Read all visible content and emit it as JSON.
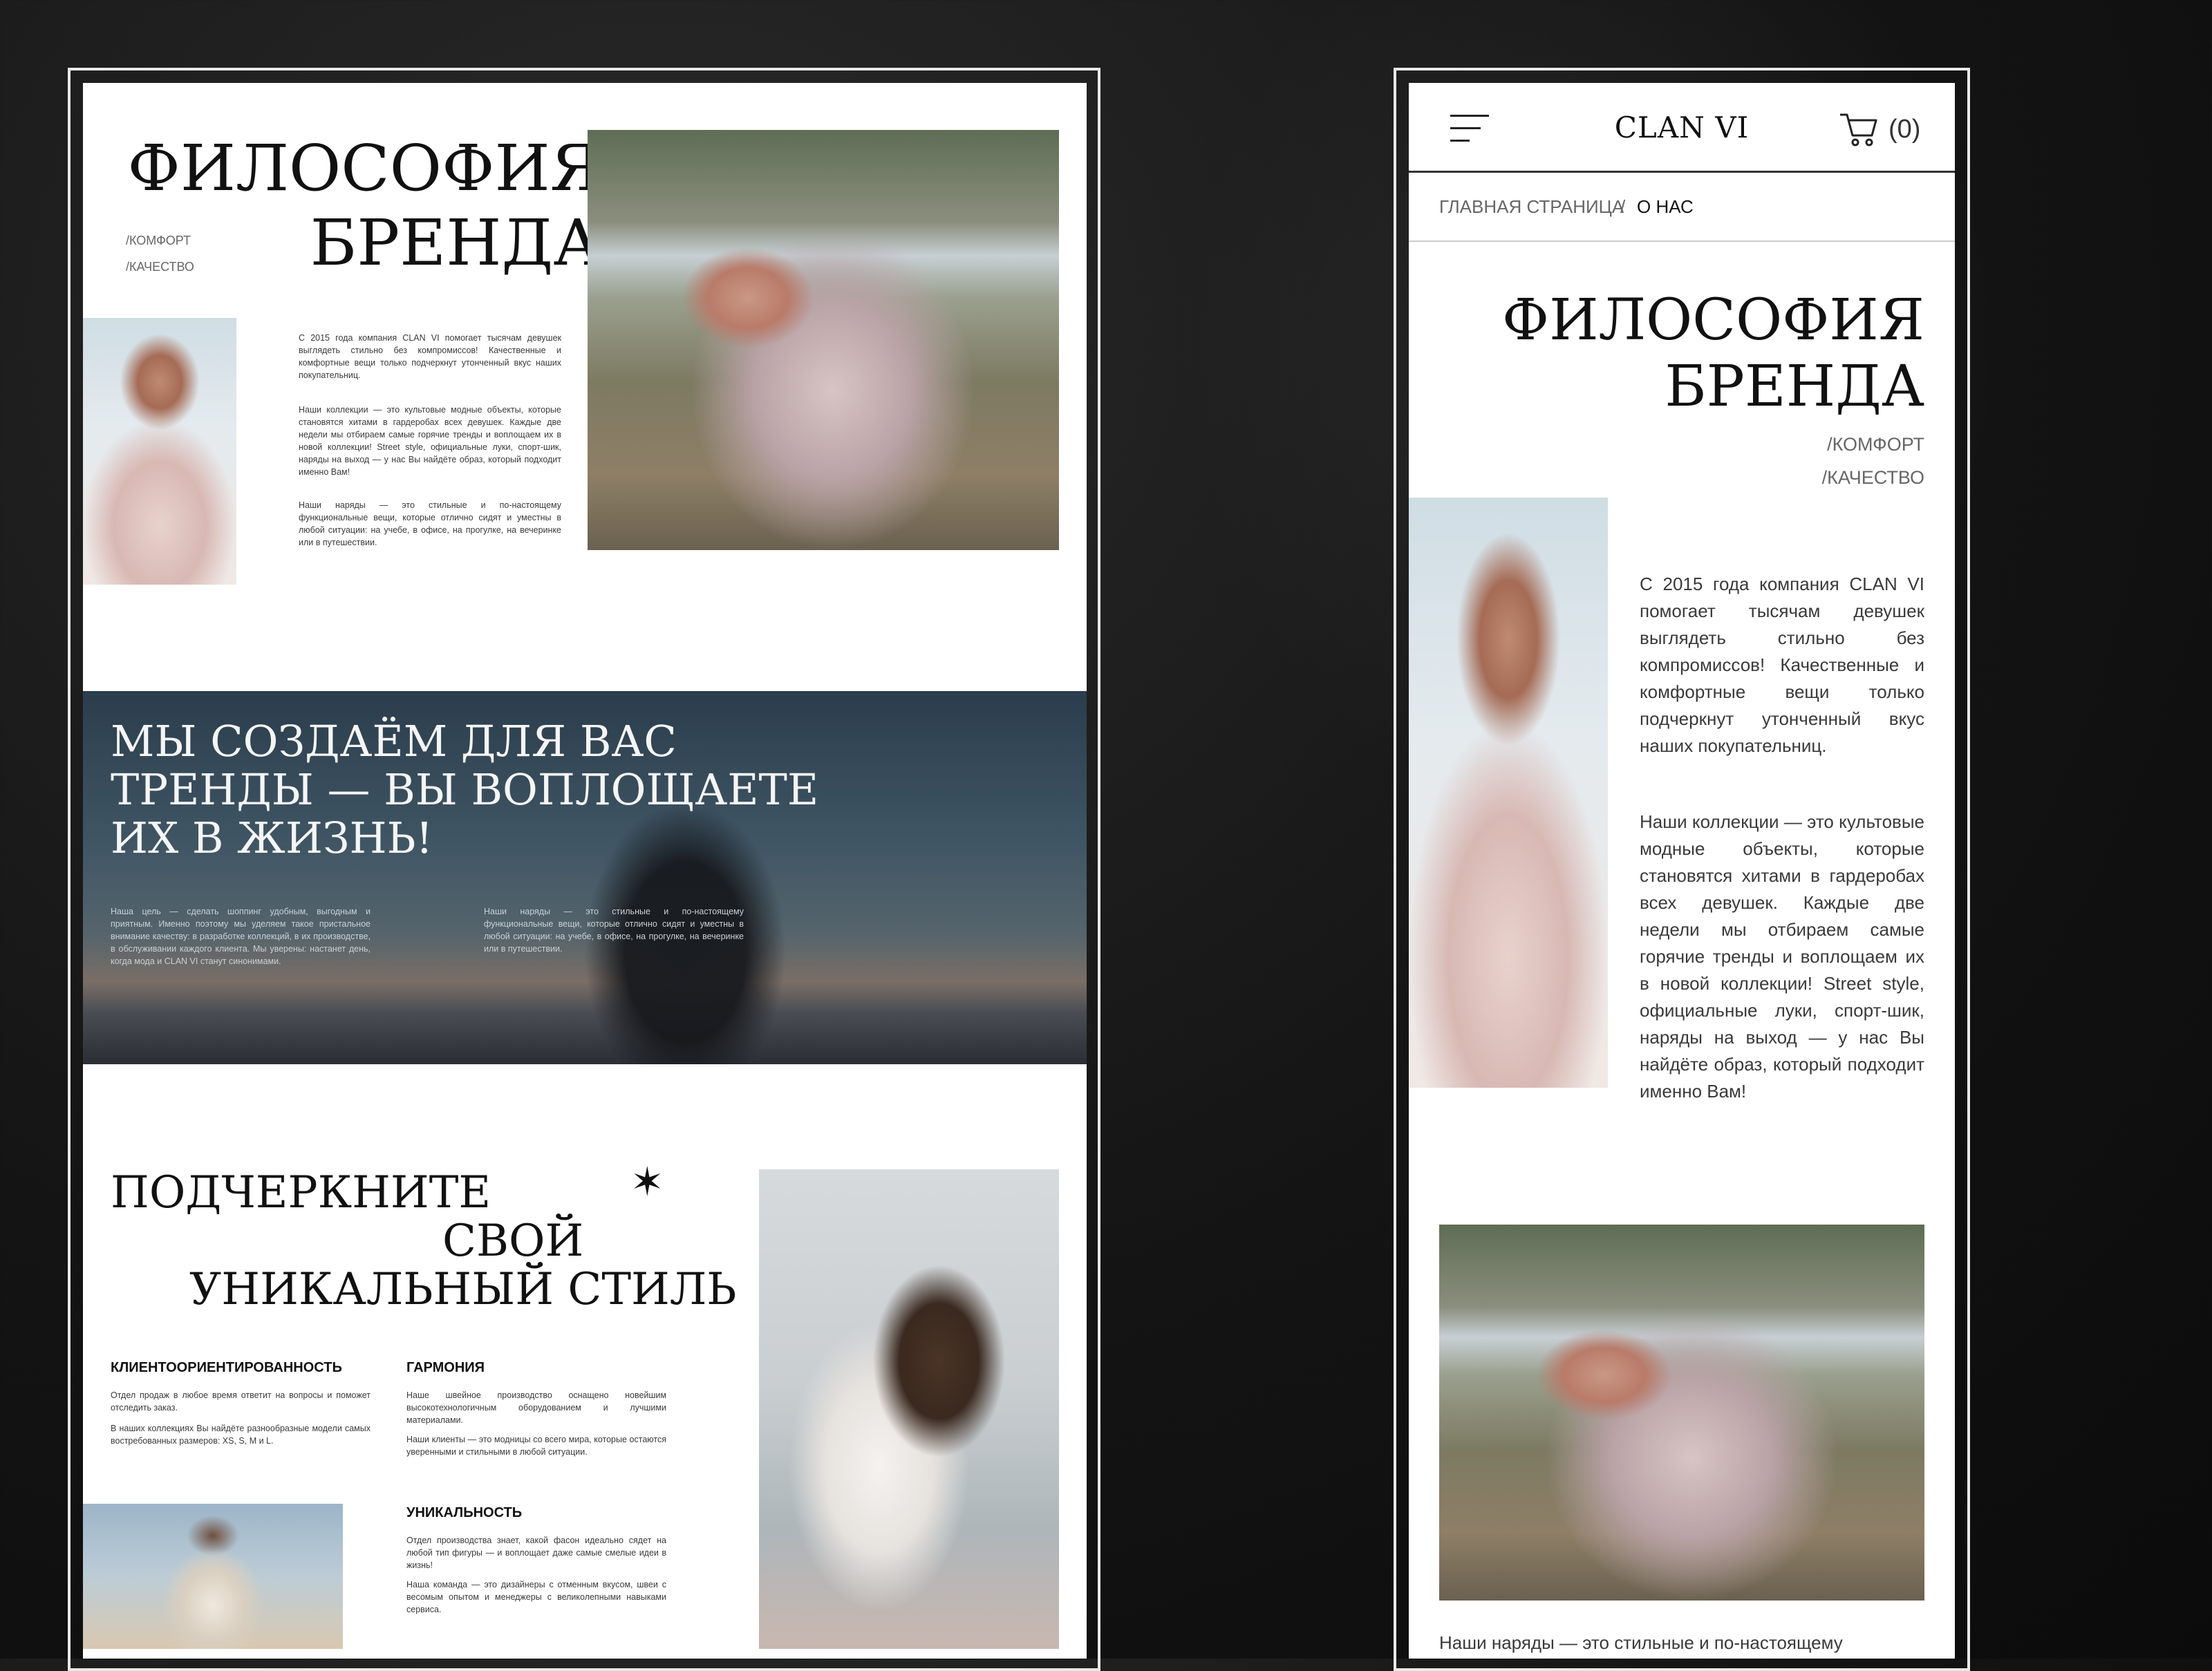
{
  "desktop": {
    "hero": {
      "title_line1": "ФИЛОСОФИЯ",
      "title_line2": "БРЕНДА",
      "tags": [
        "/КОМФОРТ",
        "/КАЧЕСТВО"
      ],
      "para1": "С 2015 года компания CLAN VI помогает тысячам девушек выглядеть стильно без компромиссов! Качественные и комфортные вещи только подчеркнут утонченный вкус наших покупательниц.",
      "para2": "Наши коллекции — это культовые модные объекты, которые становятся хитами в гардеробах всех девушек. Каждые две недели мы отбираем самые горячие тренды и воплощаем их в новой коллекции! Street style, официальные луки, спорт-шик, наряды на выход — у нас Вы найдёте образ, который подходит именно Вам!",
      "para3": "Наши наряды — это стильные и по-настоящему функциональные вещи, которые отлично сидят и уместны в любой ситуации: на учебе, в офисе, на прогулке, на вечеринке или в путешествии."
    },
    "banner": {
      "heading_line1": "МЫ СОЗДАЁМ ДЛЯ ВАС",
      "heading_line2": "ТРЕНДЫ — ВЫ ВОПЛОЩАЕТЕ",
      "heading_line3": "ИХ В ЖИЗНЬ!",
      "col1": "Наша цель — сделать шоппинг удобным, выгодным и приятным. Именно поэтому мы уделяем такое пристальное внимание качеству: в разработке коллекций, в их производстве, в обслуживании каждого клиента. Мы уверены: настанет день, когда мода и CLAN VI станут синонимами.",
      "col2": "Наши наряды — это стильные и по-настоящему функциональные вещи, которые отлично сидят и уместны в любой ситуации: на учебе, в офисе, на прогулке, на вечеринке или в путешествии."
    },
    "style": {
      "heading_line1": "ПОДЧЕРКНИТЕ",
      "heading_line2": "СВОЙ",
      "heading_line3": "УНИКАЛЬНЫЙ СТИЛЬ",
      "features": [
        {
          "title": "КЛИЕНТООРИЕНТИРОВАННОСТЬ",
          "p1": "Отдел продаж в любое время ответит на вопросы и поможет отследить заказ.",
          "p2": "В наших коллекциях Вы найдёте разнообразные модели самых востребованных размеров: XS, S, M и L."
        },
        {
          "title": "ГАРМОНИЯ",
          "p1": "Наше швейное производство оснащено новейшим высокотехнологичным оборудованием и лучшими материалами.",
          "p2": "Наши клиенты — это модницы со всего мира, которые остаются уверенными и стильными в любой ситуации."
        },
        {
          "title": "УНИКАЛЬНОСТЬ",
          "p1": "Отдел производства знает, какой фасон идеально сядет на любой тип фигуры — и воплощает даже самые смелые идеи в жизнь!",
          "p2": "Наша команда — это дизайнеры с отменным вкусом, швеи с весомым опытом и менеджеры с великолепными навыками сервиса."
        }
      ]
    }
  },
  "mobile": {
    "header": {
      "logo": "CLAN VI",
      "cart_count": "(0)"
    },
    "breadcrumb": {
      "home": "ГЛАВНАЯ СТРАНИЦА",
      "separator": "/",
      "current": "О НАС"
    },
    "hero": {
      "title_line1": "ФИЛОСОФИЯ",
      "title_line2": "БРЕНДА",
      "tags": [
        "/КОМФОРТ",
        "/КАЧЕСТВО"
      ],
      "para1": "С 2015 года компания CLAN VI помогает тысячам девушек выглядеть стильно без компромиссов! Качественные и комфортные вещи только подчеркнут утонченный вкус наших покупательниц.",
      "para2": "Наши коллекции — это культовые модные объекты, которые становятся хитами в гардеробах всех девушек. Каждые две недели мы отбираем самые горячие тренды и воплощаем их в новой коллекции! Street style, официальные луки, спорт-шик, наряды на выход — у нас Вы найдёте образ, который подходит именно Вам!",
      "para3": "Наши наряды — это стильные и по-настоящему"
    }
  }
}
